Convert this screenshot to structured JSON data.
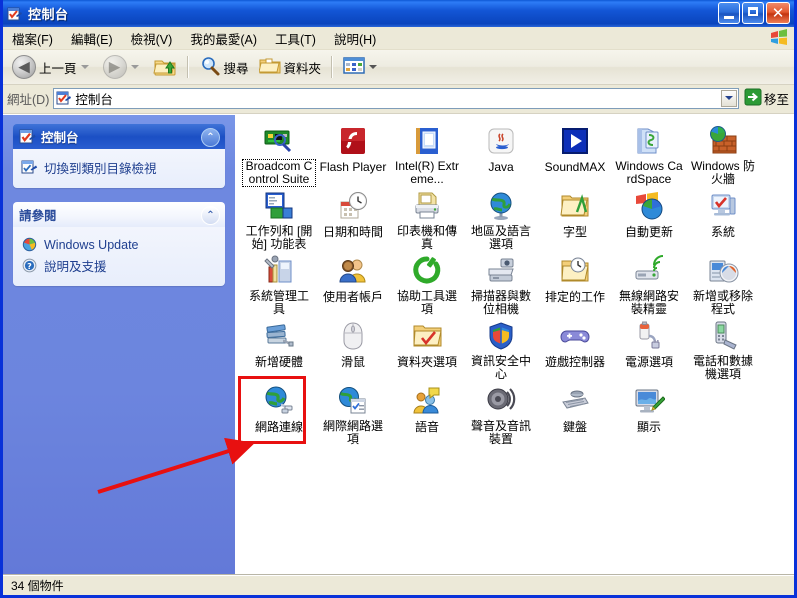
{
  "window": {
    "title": "控制台",
    "title_icon": "control-panel-icon",
    "minimize_label": "_",
    "maximize_label": "□",
    "close_label": "✕"
  },
  "menubar": {
    "items": [
      {
        "label": "檔案(F)",
        "name": "menu-file"
      },
      {
        "label": "編輯(E)",
        "name": "menu-edit"
      },
      {
        "label": "檢視(V)",
        "name": "menu-view"
      },
      {
        "label": "我的最愛(A)",
        "name": "menu-favorites"
      },
      {
        "label": "工具(T)",
        "name": "menu-tools"
      },
      {
        "label": "說明(H)",
        "name": "menu-help"
      }
    ],
    "brand_icon": "windows-flag-icon"
  },
  "toolbar": {
    "back_label": "上一頁",
    "forward_label": "",
    "up_label": "",
    "search_label": "搜尋",
    "folders_label": "資料夾",
    "views_label": ""
  },
  "address": {
    "label": "網址(D)",
    "value": "控制台",
    "go_label": "移至"
  },
  "sidebar": {
    "panels": [
      {
        "title": "控制台",
        "style": "blue",
        "icon": "control-panel-icon",
        "links": [
          {
            "label": "切換到類別目錄檢視",
            "icon": "category-view-icon"
          }
        ]
      },
      {
        "title": "請參閱",
        "style": "light",
        "icon": "",
        "links": [
          {
            "label": "Windows Update",
            "icon": "windows-update-icon"
          },
          {
            "label": "說明及支援",
            "icon": "help-support-icon"
          }
        ]
      }
    ]
  },
  "items": [
    {
      "label": "Broadcom Control Suite",
      "icon": "broadcom-icon",
      "focused": true
    },
    {
      "label": "Flash Player",
      "icon": "flash-player-icon",
      "focused": false
    },
    {
      "label": "Intel(R) Extreme...",
      "icon": "intel-extreme-icon",
      "focused": false
    },
    {
      "label": "Java",
      "icon": "java-icon",
      "focused": false
    },
    {
      "label": "SoundMAX",
      "icon": "soundmax-icon",
      "focused": false
    },
    {
      "label": "Windows CardSpace",
      "icon": "cardspace-icon",
      "focused": false
    },
    {
      "label": "Windows 防火牆",
      "icon": "firewall-icon",
      "focused": false
    },
    {
      "label": "工作列和 [開始] 功能表",
      "icon": "taskbar-startmenu-icon",
      "focused": false
    },
    {
      "label": "日期和時間",
      "icon": "date-time-icon",
      "focused": false
    },
    {
      "label": "印表機和傳真",
      "icon": "printers-faxes-icon",
      "focused": false
    },
    {
      "label": "地區及語言選項",
      "icon": "regional-language-icon",
      "focused": false
    },
    {
      "label": "字型",
      "icon": "fonts-icon",
      "focused": false
    },
    {
      "label": "自動更新",
      "icon": "automatic-updates-icon",
      "focused": false
    },
    {
      "label": "系統",
      "icon": "system-icon",
      "focused": false
    },
    {
      "label": "系統管理工具",
      "icon": "administrative-tools-icon",
      "focused": false
    },
    {
      "label": "使用者帳戶",
      "icon": "user-accounts-icon",
      "focused": false
    },
    {
      "label": "協助工具選項",
      "icon": "accessibility-icon",
      "focused": false
    },
    {
      "label": "掃描器與數位相機",
      "icon": "scanners-cameras-icon",
      "focused": false
    },
    {
      "label": "排定的工作",
      "icon": "scheduled-tasks-icon",
      "focused": false
    },
    {
      "label": "無線網路安裝精靈",
      "icon": "wireless-network-wizard-icon",
      "focused": false
    },
    {
      "label": "新增或移除程式",
      "icon": "add-remove-programs-icon",
      "focused": false
    },
    {
      "label": "新增硬體",
      "icon": "add-hardware-icon",
      "focused": false
    },
    {
      "label": "滑鼠",
      "icon": "mouse-icon",
      "focused": false
    },
    {
      "label": "資料夾選項",
      "icon": "folder-options-icon",
      "focused": false
    },
    {
      "label": "資訊安全中心",
      "icon": "security-center-icon",
      "focused": false
    },
    {
      "label": "遊戲控制器",
      "icon": "game-controllers-icon",
      "focused": false
    },
    {
      "label": "電源選項",
      "icon": "power-options-icon",
      "focused": false
    },
    {
      "label": "電話和數據機選項",
      "icon": "phone-modem-icon",
      "focused": false
    },
    {
      "label": "網路連線",
      "icon": "network-connections-icon",
      "focused": false
    },
    {
      "label": "網際網路選項",
      "icon": "internet-options-icon",
      "focused": false
    },
    {
      "label": "語音",
      "icon": "speech-icon",
      "focused": false
    },
    {
      "label": "聲音及音訊裝置",
      "icon": "sounds-audio-icon",
      "focused": false
    },
    {
      "label": "鍵盤",
      "icon": "keyboard-icon",
      "focused": false
    },
    {
      "label": "顯示",
      "icon": "display-icon",
      "focused": false
    }
  ],
  "annotation": {
    "highlight_item": "網路連線",
    "color": "#e81010"
  },
  "statusbar": {
    "text": "34 個物件"
  }
}
